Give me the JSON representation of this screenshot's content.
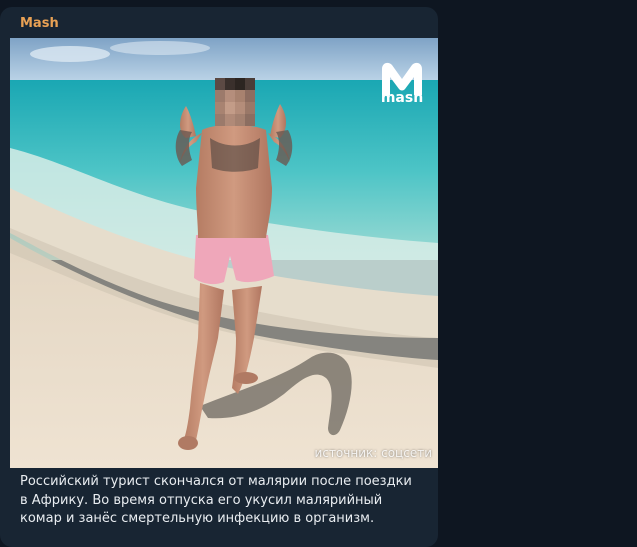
{
  "channel": {
    "name": "Mash"
  },
  "photo": {
    "logo_text": "mash",
    "source_caption": "источник: соцсети"
  },
  "message": {
    "text": "Российский турист скончался от малярии после поездки в Африку. Во время отпуска его укусил малярийный комар и занёс смертельную инфекцию в организм."
  },
  "colors": {
    "background": "#0e1621",
    "bubble": "#182533",
    "channel_name": "#e8a154",
    "text": "#e9edf1"
  }
}
